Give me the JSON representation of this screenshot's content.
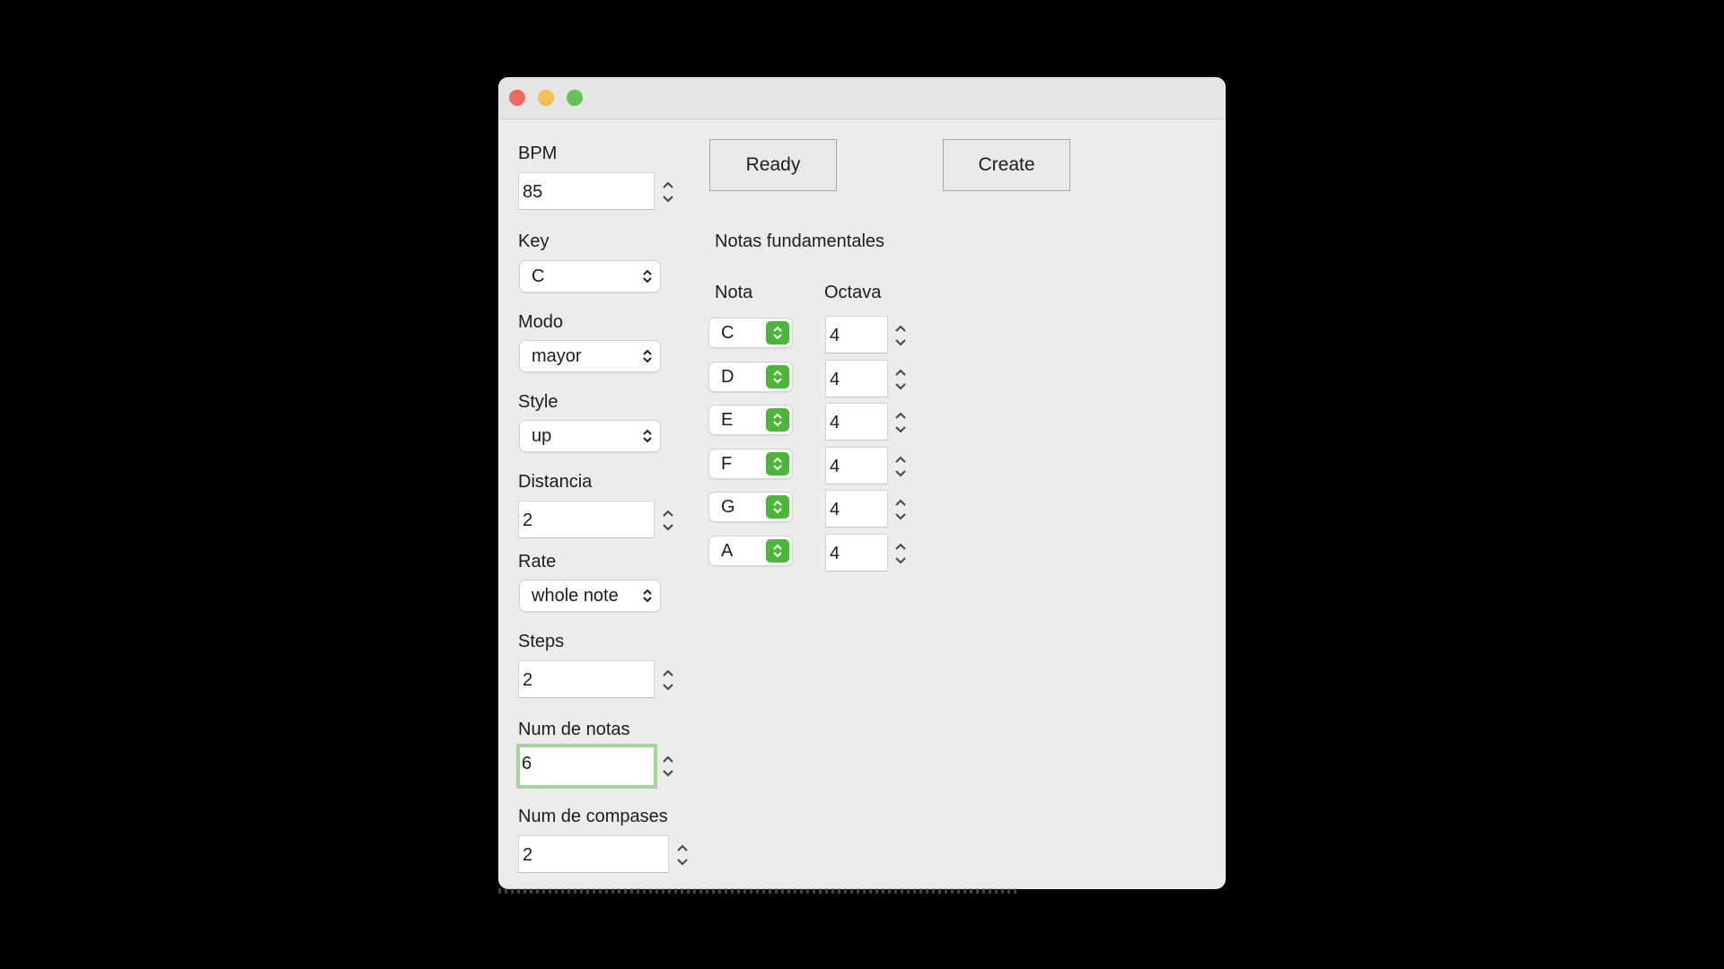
{
  "window": {
    "title": "",
    "accent_color": "#4cb63b",
    "focus_color": "#a5d49b"
  },
  "left_panel": {
    "bpm": {
      "label": "BPM",
      "value": "85"
    },
    "key": {
      "label": "Key",
      "selected": "C"
    },
    "modo": {
      "label": "Modo",
      "selected": "mayor"
    },
    "style": {
      "label": "Style",
      "selected": "up"
    },
    "distancia": {
      "label": "Distancia",
      "value": "2"
    },
    "rate": {
      "label": "Rate",
      "selected": "whole note"
    },
    "steps": {
      "label": "Steps",
      "value": "2"
    },
    "num_notas": {
      "label": "Num de notas",
      "value": "6"
    },
    "num_compases": {
      "label": "Num de compases",
      "value": "2"
    }
  },
  "toolbar": {
    "ready_label": "Ready",
    "create_label": "Create"
  },
  "fundamentals": {
    "title": "Notas fundamentales",
    "col_nota": "Nota",
    "col_octava": "Octava",
    "rows": [
      {
        "nota": "C",
        "octava": "4"
      },
      {
        "nota": "D",
        "octava": "4"
      },
      {
        "nota": "E",
        "octava": "4"
      },
      {
        "nota": "F",
        "octava": "4"
      },
      {
        "nota": "G",
        "octava": "4"
      },
      {
        "nota": "A",
        "octava": "4"
      }
    ]
  }
}
